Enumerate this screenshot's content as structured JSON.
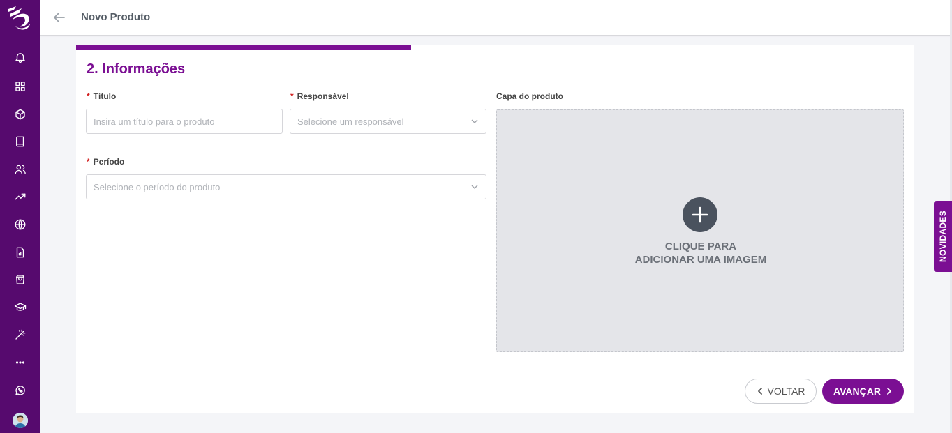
{
  "header": {
    "title": "Novo Produto"
  },
  "step": {
    "title": "2. Informações",
    "progress": 0.4
  },
  "form": {
    "titulo": {
      "label": "Título",
      "placeholder": "Insira um título para o produto"
    },
    "responsavel": {
      "label": "Responsável",
      "placeholder": "Selecione um responsável"
    },
    "periodo": {
      "label": "Período",
      "placeholder": "Selecione o período do produto"
    },
    "required_mark": "*"
  },
  "cover": {
    "label": "Capa do produto",
    "cta_line1": "CLIQUE PARA",
    "cta_line2": "ADICIONAR UMA IMAGEM"
  },
  "actions": {
    "back": "VOLTAR",
    "next": "AVANÇAR"
  },
  "side_tab": {
    "label": "NOVIDADES"
  },
  "sidebar": {
    "icons": [
      "bell-icon",
      "dashboard-icon",
      "box-icon",
      "book-icon",
      "users-icon",
      "trending-icon",
      "globe-icon",
      "report-icon",
      "shopping-bag-icon",
      "graduation-cap-icon",
      "magic-wand-icon",
      "more-icon",
      "whatsapp-icon"
    ]
  },
  "colors": {
    "sidebar": "#560a6e",
    "accent": "#7b0f93",
    "required": "#d11a1a"
  }
}
